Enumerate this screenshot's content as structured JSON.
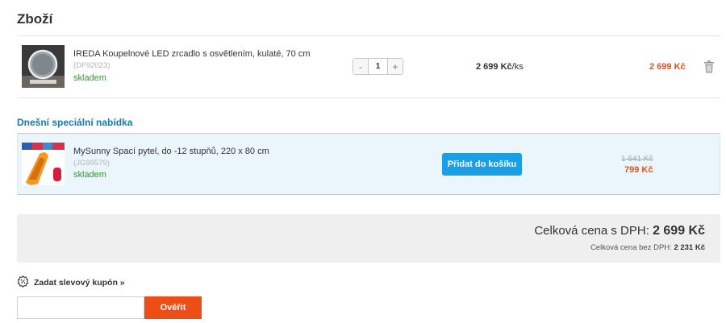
{
  "heading": "Zboží",
  "cart_item": {
    "name": "IREDA Koupelnové LED zrcadlo s osvětlením, kulaté, 70 cm",
    "code": "(DF92023)",
    "stock": "skladem",
    "qty_minus": "-",
    "qty_value": "1",
    "qty_plus": "+",
    "unit_price": "2 699 Kč",
    "unit_suffix": "/ks",
    "total_price": "2 699 Kč",
    "delete_icon": "trash-icon"
  },
  "offer": {
    "title": "Dnešní speciální nabídka",
    "name": "MySunny Spací pytel, do -12 stupňů, 220 x 80 cm",
    "code": "(JG99579)",
    "stock": "skladem",
    "button": "Přidat do košíku",
    "old_price": "1 641 Kč",
    "new_price": "799 Kč"
  },
  "summary": {
    "total_label": "Celková cena s DPH:",
    "total_value": "2 699 Kč",
    "net_label": "Celková cena bez DPH:",
    "net_value": "2 231 Kč"
  },
  "coupon": {
    "link": "Zadat slevový kupón »",
    "icon": "coupon-badge-icon",
    "input_value": "",
    "button": "Ověřit"
  },
  "colors": {
    "accent_orange": "#e8501a",
    "button_blue": "#1a9ee6",
    "offer_title": "#1679a8",
    "stock_green": "#2c9b2c"
  }
}
